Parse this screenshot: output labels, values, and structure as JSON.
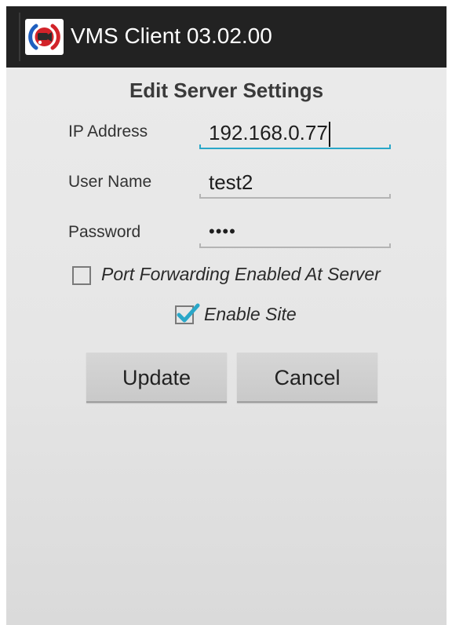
{
  "app": {
    "title": "VMS Client 03.02.00",
    "icon": "vms-camera-logo-icon"
  },
  "form": {
    "heading": "Edit Server Settings",
    "ip_address": {
      "label": "IP Address",
      "value": "192.168.0.77"
    },
    "user_name": {
      "label": "User Name",
      "value": "test2"
    },
    "password": {
      "label": "Password",
      "value": "••••"
    }
  },
  "options": {
    "port_forwarding": {
      "label": "Port Forwarding Enabled At Server",
      "checked": false
    },
    "enable_site": {
      "label": "Enable Site",
      "checked": true
    }
  },
  "buttons": {
    "update": "Update",
    "cancel": "Cancel"
  },
  "colors": {
    "titlebar": "#222222",
    "focus_accent": "#2aa7c8",
    "logo_red": "#d2232a",
    "logo_blue": "#1f5fbf"
  }
}
